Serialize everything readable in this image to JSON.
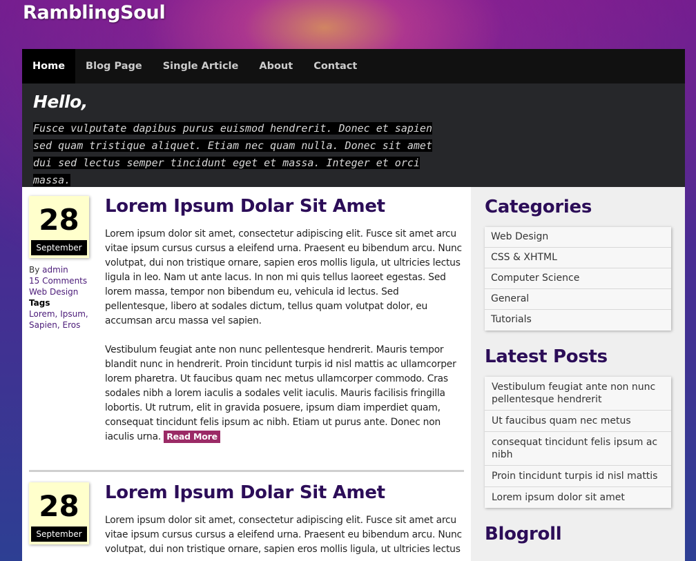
{
  "site": {
    "title": "RamblingSoul"
  },
  "nav": {
    "items": [
      {
        "label": "Home",
        "active": true
      },
      {
        "label": "Blog Page"
      },
      {
        "label": "Single Article"
      },
      {
        "label": "About"
      },
      {
        "label": "Contact"
      }
    ]
  },
  "hero": {
    "heading": "Hello,",
    "text": "Fusce vulputate dapibus purus euismod hendrerit. Donec et sapien sed quam tristique aliquet. Etiam nec quam nulla. Donec sit amet dui sed lectus semper tincidunt eget et massa. Integer et orci massa."
  },
  "posts": [
    {
      "day": "28",
      "month": "September",
      "by_prefix": "By ",
      "author": "admin",
      "comments": "15 Comments",
      "category": "Web Design",
      "tags_label": "Tags",
      "tags_line1": "Lorem, Ipsum,",
      "tags_line2": "Sapien, Eros",
      "title": "Lorem Ipsum Dolar Sit Amet",
      "para1": "Lorem ipsum dolor sit amet, consectetur adipiscing elit. Fusce sit amet arcu vitae ipsum cursus cursus a eleifend urna. Praesent eu bibendum arcu. Nunc volutpat, dui non tristique ornare, sapien eros mollis ligula, ut ultricies lectus ligula in leo. Nam ut ante lacus. In non mi quis tellus laoreet egestas. Sed lorem massa, tempor non bibendum eu, vehicula id lectus. Sed pellentesque, libero at sodales dictum, tellus quam volutpat dolor, eu accumsan arcu massa vel sapien.",
      "para2": "Vestibulum feugiat ante non nunc pellentesque hendrerit. Mauris tempor blandit nunc in hendrerit. Proin tincidunt turpis id nisl mattis ac ullamcorper lorem pharetra. Ut faucibus quam nec metus ullamcorper commodo. Cras sodales nibh a lorem iaculis a sodales velit iaculis. Mauris facilisis fringilla lobortis. Ut rutrum, elit in gravida posuere, ipsum diam imperdiet quam, consequat tincidunt felis ipsum ac nibh. Etiam ut purus ante. Donec non iaculis urna.",
      "read_more": "Read More"
    },
    {
      "day": "28",
      "month": "September",
      "title": "Lorem Ipsum Dolar Sit Amet",
      "para1": "Lorem ipsum dolor sit amet, consectetur adipiscing elit. Fusce sit amet arcu vitae ipsum cursus cursus a eleifend urna. Praesent eu bibendum arcu. Nunc volutpat, dui non tristique ornare, sapien eros mollis ligula, ut ultricies lectus"
    }
  ],
  "sidebar": {
    "categories_title": "Categories",
    "categories": [
      "Web Design",
      "CSS & XHTML",
      "Computer Science",
      "General",
      "Tutorials"
    ],
    "latest_title": "Latest Posts",
    "latest": [
      "Vestibulum feugiat ante non nunc pellentesque hendrerit",
      "Ut faucibus quam nec metus",
      "consequat tincidunt felis ipsum ac nibh",
      "Proin tincidunt turpis id nisl mattis",
      "Lorem ipsum dolor sit amet"
    ],
    "blogroll_title": "Blogroll"
  }
}
